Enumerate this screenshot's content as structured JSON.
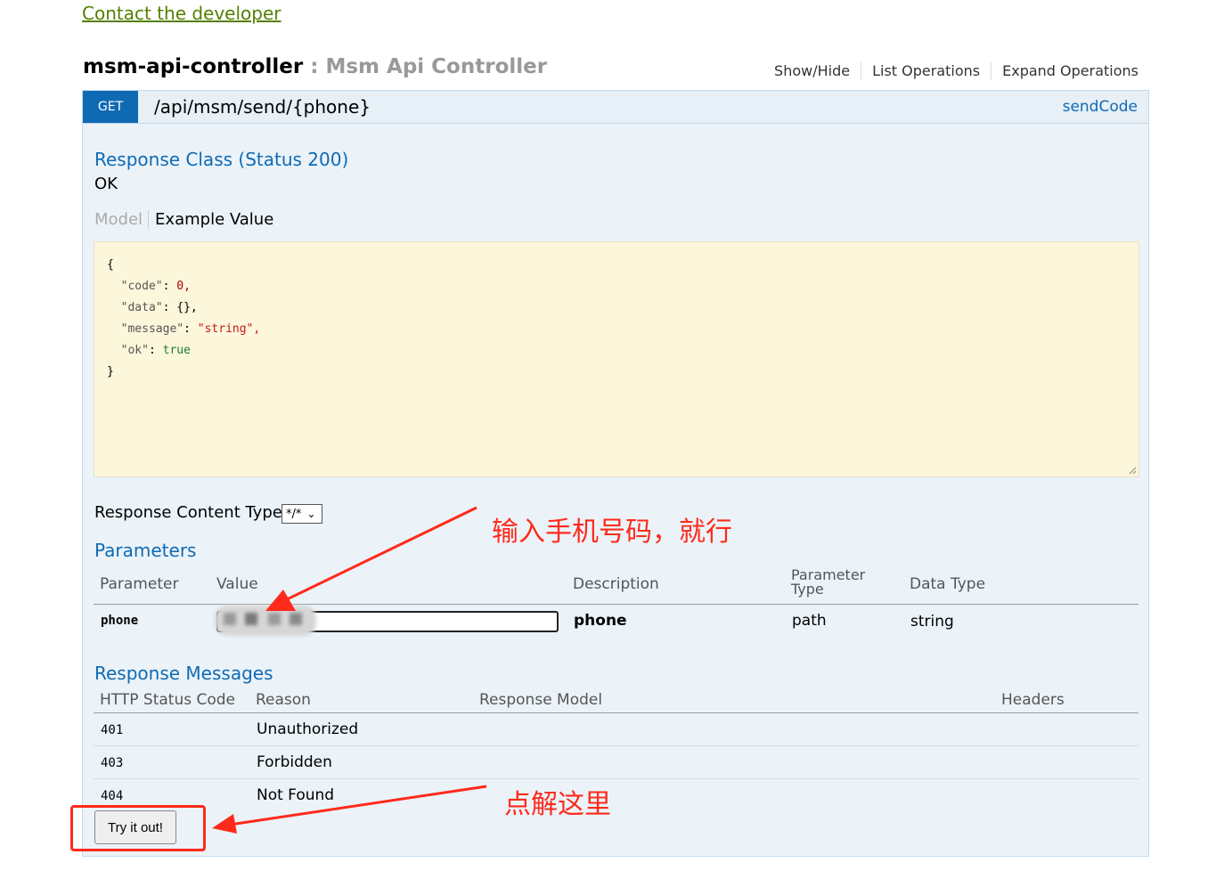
{
  "contact_link": "Contact the developer",
  "controller": {
    "name": "msm-api-controller",
    "separator": " : ",
    "description": "Msm Api Controller",
    "links": [
      "Show/Hide",
      "List Operations",
      "Expand Operations"
    ]
  },
  "operation": {
    "method": "GET",
    "path": "/api/msm/send/{phone}",
    "nickname": "sendCode",
    "method_color": "#0f6ab4",
    "response_class_heading": "Response Class (Status 200)",
    "response_class_value": "OK",
    "tabs": [
      "Model",
      "Example Value"
    ],
    "example_lines": [
      {
        "open": "{"
      },
      {
        "key": "\"code\"",
        "value": "0,",
        "type": "number"
      },
      {
        "key": "\"data\"",
        "value": "{},",
        "type": "plain"
      },
      {
        "key": "\"message\"",
        "value": "\"string\",",
        "type": "string"
      },
      {
        "key": "\"ok\"",
        "value": "true",
        "type": "bool"
      },
      {
        "close": "}"
      }
    ],
    "response_content_type_label": "Response Content Type",
    "response_content_type_value": "*/*",
    "parameters_heading": "Parameters",
    "param_headers": [
      "Parameter",
      "Value",
      "Description",
      "Parameter Type",
      "Data Type"
    ],
    "params": [
      {
        "name": "phone",
        "value": "",
        "description": "phone",
        "param_type": "path",
        "data_type": "string"
      }
    ],
    "response_messages_heading": "Response Messages",
    "msg_headers": [
      "HTTP Status Code",
      "Reason",
      "Response Model",
      "Headers"
    ],
    "messages": [
      {
        "code": "401",
        "reason": "Unauthorized"
      },
      {
        "code": "403",
        "reason": "Forbidden"
      },
      {
        "code": "404",
        "reason": "Not Found"
      }
    ],
    "try_button": "Try it out!"
  },
  "annotations": {
    "input_hint": "输入手机号码，就行",
    "click_hint": "点解这里",
    "color": "#ff2a1a"
  }
}
